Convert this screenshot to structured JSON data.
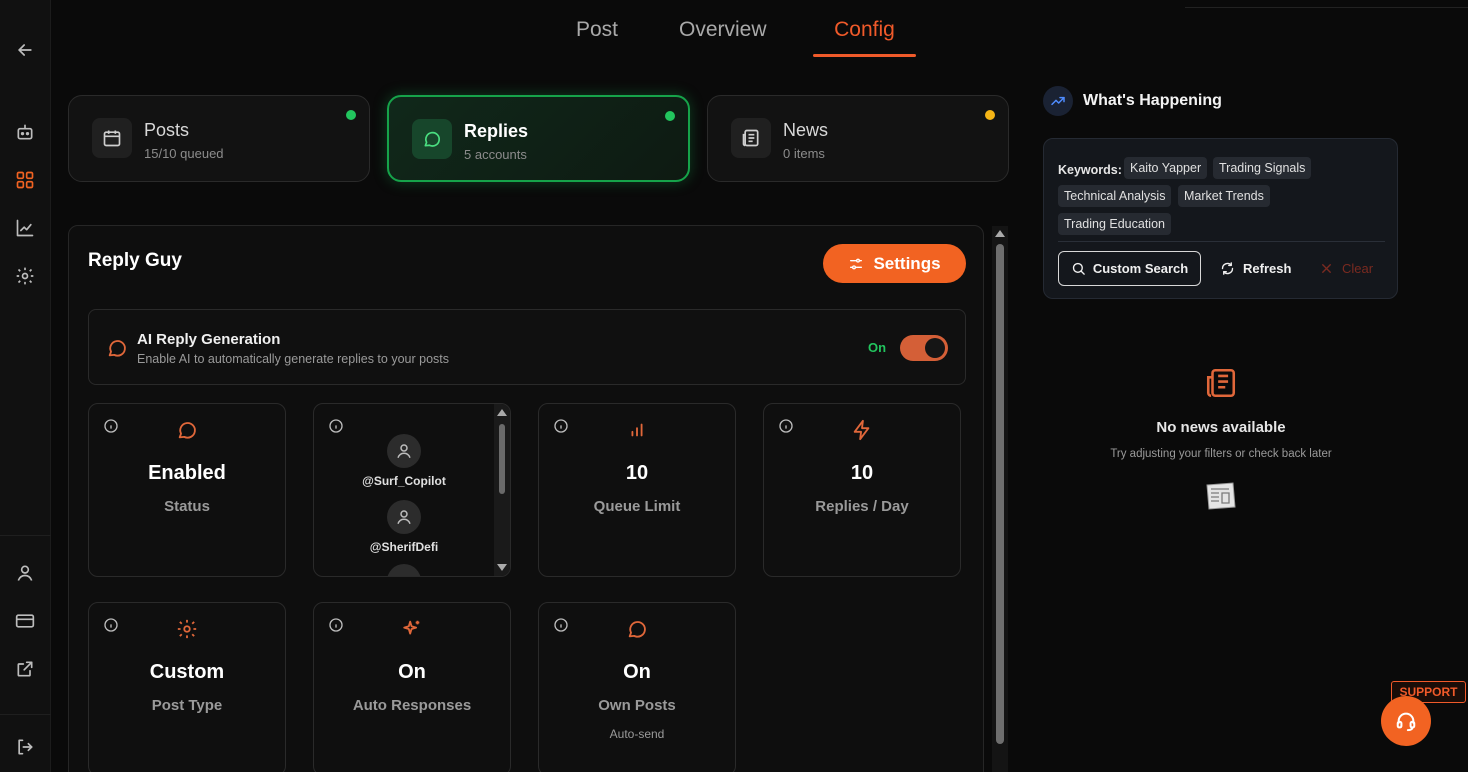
{
  "tabs": [
    {
      "label": "Post"
    },
    {
      "label": "Overview"
    },
    {
      "label": "Config",
      "active": true
    }
  ],
  "cards": {
    "posts": {
      "title": "Posts",
      "sub": "15/10 queued",
      "status_color": "#22c55e"
    },
    "replies": {
      "title": "Replies",
      "sub": "5 accounts",
      "status_color": "#22c55e"
    },
    "news": {
      "title": "News",
      "sub": "0 items",
      "status_color": "#f5b516"
    }
  },
  "reply_guy": {
    "title": "Reply Guy",
    "settings_label": "Settings",
    "ai": {
      "title": "AI Reply Generation",
      "desc": "Enable AI to automatically generate replies to your posts",
      "state_label": "On",
      "enabled": true
    },
    "stats": {
      "status": {
        "value": "Enabled",
        "label": "Status"
      },
      "accounts": [
        "@Surf_Copilot",
        "@SherifDefi"
      ],
      "queue": {
        "value": "10",
        "label": "Queue Limit"
      },
      "replies_day": {
        "value": "10",
        "label": "Replies / Day"
      },
      "post_type": {
        "value": "Custom",
        "label": "Post Type"
      },
      "auto": {
        "value": "On",
        "label": "Auto Responses"
      },
      "own": {
        "value": "On",
        "label": "Own Posts",
        "sub": "Auto-send"
      }
    }
  },
  "whats_happening": {
    "title": "What's Happening",
    "keywords_label": "Keywords:",
    "keywords": [
      "Kaito Yapper",
      "Trading Signals",
      "Technical Analysis",
      "Market Trends",
      "Trading Education"
    ],
    "custom_search": "Custom Search",
    "refresh": "Refresh",
    "clear": "Clear",
    "empty_title": "No news available",
    "empty_sub": "Try adjusting your filters or check back later"
  },
  "support": {
    "label": "SUPPORT"
  },
  "colors": {
    "accent": "#f26322",
    "active_green": "#16a34a",
    "on_green": "#22c55e"
  }
}
